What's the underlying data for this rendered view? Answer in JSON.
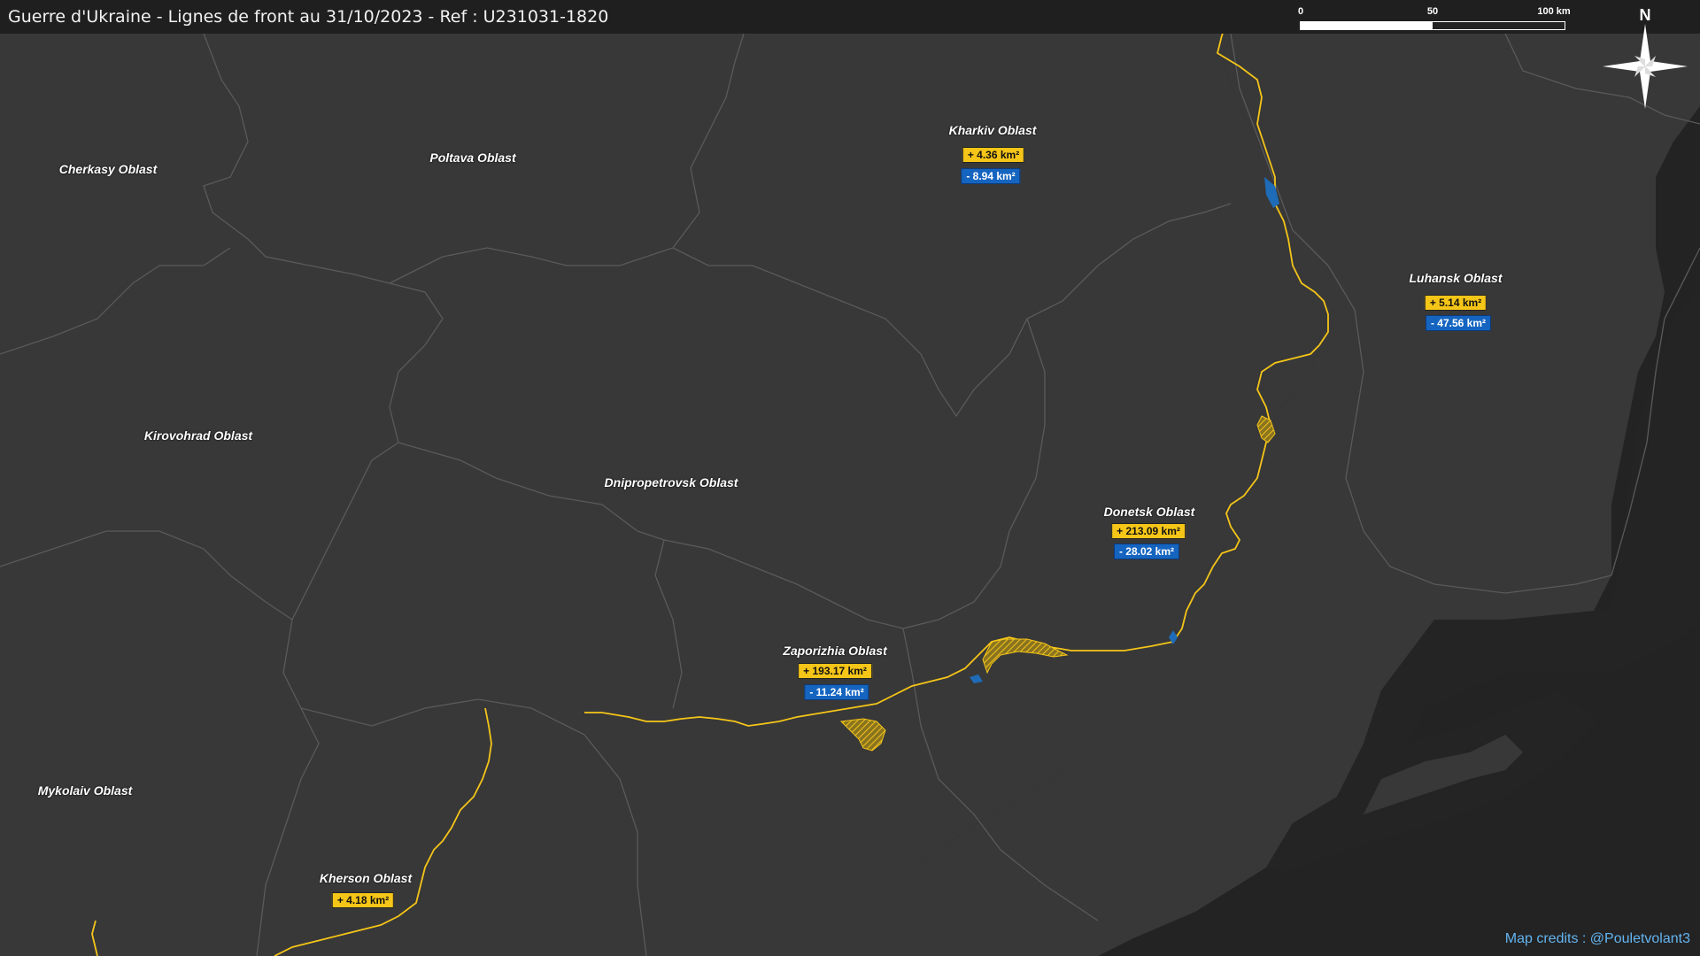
{
  "map": {
    "title": "Guerre d'Ukraine - Lignes de front au 31/10/2023 - Ref : U231031-1820",
    "credits": "Map credits : @Pouletvolant3",
    "north": "N",
    "scale": {
      "labels": [
        "0",
        "50",
        "100 km"
      ]
    },
    "colors": {
      "background": "#232323",
      "land": "#383838",
      "border": "#5a5a5a",
      "front_line": "#f5c518",
      "gain": "#f5c518",
      "loss": "#1565c0",
      "credits": "#63b4f0"
    },
    "oblasts": [
      {
        "name": "Cherkasy Oblast"
      },
      {
        "name": "Poltava Oblast"
      },
      {
        "name": "Kharkiv Oblast",
        "gain": "+ 4.36 km²",
        "loss": "- 8.94 km²"
      },
      {
        "name": "Luhansk Oblast",
        "gain": "+ 5.14 km²",
        "loss": "- 47.56 km²"
      },
      {
        "name": "Kirovohrad Oblast"
      },
      {
        "name": "Dnipropetrovsk Oblast"
      },
      {
        "name": "Donetsk Oblast",
        "gain": "+ 213.09 km²",
        "loss": "- 28.02 km²"
      },
      {
        "name": "Zaporizhia Oblast",
        "gain": "+ 193.17 km²",
        "loss": "- 11.24 km²"
      },
      {
        "name": "Mykolaiv Oblast"
      },
      {
        "name": "Kherson Oblast",
        "gain": "+ 4.18 km²"
      }
    ]
  }
}
